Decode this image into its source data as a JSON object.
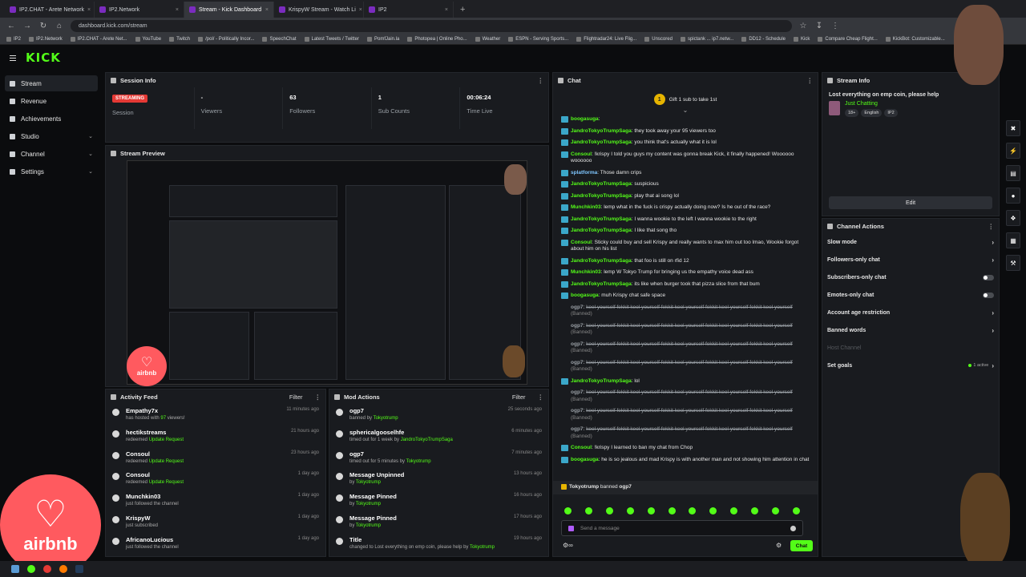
{
  "browser": {
    "tabs": [
      {
        "title": "IP2.CHAT - Arete Network",
        "active": false
      },
      {
        "title": "IP2.Network",
        "active": false
      },
      {
        "title": "Stream - Kick Dashboard",
        "active": true
      },
      {
        "title": "KrispyW Stream - Watch Li",
        "active": false
      },
      {
        "title": "IP2",
        "active": false
      }
    ],
    "new_tab": "+",
    "url": "dashboard.kick.com/stream",
    "bookmarks": [
      "IP2",
      "IP2.Network",
      "IP2.CHAT - Arete Net...",
      "YouTube",
      "Twitch",
      "/pol/ - Politically Incor...",
      "SpeechChat",
      "Latest Tweets / Twitter",
      "PomfJain.la",
      "Photopea | Online Pho...",
      "Weather",
      "ESPN - Serving Sports...",
      "Flightradar24: Live Flig...",
      "Unscored",
      "spictank ... ip7.netw...",
      "DD12 - Schedule",
      "Kick",
      "Compare Cheap Flight...",
      "KickBot: Customizable..."
    ]
  },
  "app": {
    "logo": "KICK"
  },
  "sidebar": {
    "items": [
      {
        "label": "Stream",
        "active": true,
        "chevron": false
      },
      {
        "label": "Revenue",
        "active": false,
        "chevron": false
      },
      {
        "label": "Achievements",
        "active": false,
        "chevron": false
      },
      {
        "label": "Studio",
        "active": false,
        "chevron": true
      },
      {
        "label": "Channel",
        "active": false,
        "chevron": true
      },
      {
        "label": "Settings",
        "active": false,
        "chevron": true
      }
    ]
  },
  "session": {
    "title": "Session Info",
    "status": "STREAMING",
    "status_label": "Session",
    "stats": [
      {
        "value": "-",
        "label": "Viewers"
      },
      {
        "value": "63",
        "label": "Followers"
      },
      {
        "value": "1",
        "label": "Sub Counts"
      },
      {
        "value": "00:06:24",
        "label": "Time Live"
      }
    ]
  },
  "preview": {
    "title": "Stream Preview",
    "overlay_brand": "airbnb"
  },
  "activity": {
    "title": "Activity Feed",
    "filter": "Filter",
    "items": [
      {
        "name": "Empathy7x",
        "pre": "has hosted with ",
        "hl": "97",
        "post": " viewers!",
        "time": "11 minutes ago"
      },
      {
        "name": "hectikstreams",
        "pre": "redeemed ",
        "hl": "Update Request",
        "post": "",
        "time": "21 hours ago"
      },
      {
        "name": "Consoul",
        "pre": "redeemed ",
        "hl": "Update Request",
        "post": "",
        "time": "23 hours ago"
      },
      {
        "name": "Consoul",
        "pre": "redeemed ",
        "hl": "Update Request",
        "post": "",
        "time": "1 day ago"
      },
      {
        "name": "Munchkin03",
        "pre": "just followed the channel",
        "hl": "",
        "post": "",
        "time": "1 day ago"
      },
      {
        "name": "KrispyW",
        "pre": "just subscribed",
        "hl": "",
        "post": "",
        "time": "1 day ago"
      },
      {
        "name": "AfricanoLucious",
        "pre": "just followed the channel",
        "hl": "",
        "post": "",
        "time": "1 day ago"
      }
    ]
  },
  "mod": {
    "title": "Mod Actions",
    "filter": "Filter",
    "items": [
      {
        "name": "ogp7",
        "pre": "banned by ",
        "hl": "Tokyotrump",
        "time": "25 seconds ago"
      },
      {
        "name": "sphericalgooselhfe",
        "pre": "timed out for 1 week by ",
        "hl": "JandroTokyoTrumpSaga",
        "time": "6 minutes ago"
      },
      {
        "name": "ogp7",
        "pre": "timed out for 5 minutes by ",
        "hl": "Tokyotrump",
        "time": "7 minutes ago"
      },
      {
        "name": "Message Unpinned",
        "pre": "by ",
        "hl": "Tokyotrump",
        "time": "13 hours ago"
      },
      {
        "name": "Message Pinned",
        "pre": "by ",
        "hl": "Tokyotrump",
        "time": "16 hours ago"
      },
      {
        "name": "Message Pinned",
        "pre": "by ",
        "hl": "Tokyotrump",
        "time": "17 hours ago"
      },
      {
        "name": "Title",
        "pre": "changed to Lost everything on emp coin, please help by ",
        "hl": "Tokyotrump",
        "time": "19 hours ago"
      }
    ]
  },
  "chat": {
    "title": "Chat",
    "gift_text": "Gift 1 sub to take 1st",
    "gift_coin": "1",
    "messages": [
      {
        "user": "boogasuga",
        "color": "#53fc18",
        "text": "",
        "banned": false
      },
      {
        "user": "JandroTokyoTrumpSaga",
        "color": "#53fc18",
        "text": "they took away your 95 viewers too",
        "banned": false
      },
      {
        "user": "JandroTokyoTrumpSaga",
        "color": "#53fc18",
        "text": "you think that's actually what it is lol",
        "banned": false
      },
      {
        "user": "Consoul",
        "color": "#53fc18",
        "text": "!krispy I told you guys my content was gonna break Kick, it finally happened! Woooooo woooooo",
        "banned": false
      },
      {
        "user": "splatforma",
        "color": "#7fc6ff",
        "text": "Those damn crips",
        "banned": false
      },
      {
        "user": "JandroTokyoTrumpSaga",
        "color": "#53fc18",
        "text": "suspicious",
        "banned": false
      },
      {
        "user": "JandroTokyoTrumpSaga",
        "color": "#53fc18",
        "text": "play that ai song lol",
        "banned": false
      },
      {
        "user": "Munchkin03",
        "color": "#53fc18",
        "text": "lemp what in the fuck is crispy actually doing now? Is he out of the race?",
        "banned": false
      },
      {
        "user": "JandroTokyoTrumpSaga",
        "color": "#53fc18",
        "text": "I wanna wookie to the left I wanna wookie to the right",
        "banned": false
      },
      {
        "user": "JandroTokyoTrumpSaga",
        "color": "#53fc18",
        "text": "I like that song tho",
        "banned": false
      },
      {
        "user": "Consoul",
        "color": "#53fc18",
        "text": "Sticky could buy and sell Krispy and really wants to max him out too lmao, Wookie forgot about him on his list",
        "banned": false
      },
      {
        "user": "JandroTokyoTrumpSaga",
        "color": "#53fc18",
        "text": "that foo is still on rfid 12",
        "banned": false
      },
      {
        "user": "Munchkin03",
        "color": "#53fc18",
        "text": "lemp W Tokyo Trump for bringing us the empathy voice dead ass",
        "banned": false
      },
      {
        "user": "JandroTokyoTrumpSaga",
        "color": "#53fc18",
        "text": "its like when burger took that pizza slice from that bum",
        "banned": false
      },
      {
        "user": "boogasuga",
        "color": "#53fc18",
        "text": "muh Krispy chat safe space",
        "banned": false
      },
      {
        "user": "ogp7",
        "color": "#9aa0a6",
        "text": "keel yourself fekkit keel yourself fekkit keel yourself fekkit keel yourself fekkit keel yourself",
        "banned": true,
        "ban_label": "(Banned)"
      },
      {
        "user": "ogp7",
        "color": "#9aa0a6",
        "text": "keel yourself fekkit keel yourself fekkit keel yourself fekkit keel yourself fekkit keel yourself",
        "banned": true,
        "ban_label": "(Banned)"
      },
      {
        "user": "ogp7",
        "color": "#9aa0a6",
        "text": "keel yourself fekkit keel yourself fekkit keel yourself fekkit keel yourself fekkit keel yourself",
        "banned": true,
        "ban_label": "(Banned)"
      },
      {
        "user": "ogp7",
        "color": "#9aa0a6",
        "text": "keel yourself fekkit keel yourself fekkit keel yourself fekkit keel yourself fekkit keel yourself",
        "banned": true,
        "ban_label": "(Banned)"
      },
      {
        "user": "JandroTokyoTrumpSaga",
        "color": "#53fc18",
        "text": "lol",
        "banned": false
      },
      {
        "user": "ogp7",
        "color": "#9aa0a6",
        "text": "keel yourself fekkit keel yourself fekkit keel yourself fekkit keel yourself fekkit keel yourself",
        "banned": true,
        "ban_label": "(Banned)"
      },
      {
        "user": "ogp7",
        "color": "#9aa0a6",
        "text": "keel yourself fekkit keel yourself fekkit keel yourself fekkit keel yourself fekkit keel yourself",
        "banned": true,
        "ban_label": "(Banned)"
      },
      {
        "user": "ogp7",
        "color": "#9aa0a6",
        "text": "keel yourself fekkit keel yourself fekkit keel yourself fekkit keel yourself fekkit keel yourself",
        "banned": true,
        "ban_label": "(Banned)"
      },
      {
        "user": "Consoul",
        "color": "#53fc18",
        "text": "!krispy I learned to ban my chat from Chop",
        "banned": false
      },
      {
        "user": "boogasuga",
        "color": "#53fc18",
        "text": "he is so jealous and mad Krispy is with another man and not showing him attention in chat",
        "banned": false
      }
    ],
    "system": {
      "actor": "Tokyotrump",
      "action": " banned ",
      "target": "ogp7"
    },
    "input_placeholder": "Send a message",
    "send_label": "Chat"
  },
  "stream_info": {
    "title": "Stream Info",
    "stream_title": "Lost everything on emp coin, please help",
    "category": "Just Chatting",
    "tags": [
      "18+",
      "English",
      "IP2"
    ],
    "edit_label": "Edit"
  },
  "channel_actions": {
    "title": "Channel Actions",
    "items": [
      {
        "label": "Slow mode",
        "control": "chevron",
        "extra": ""
      },
      {
        "label": "Followers-only chat",
        "control": "chevron",
        "extra": ""
      },
      {
        "label": "Subscribers-only chat",
        "control": "toggle",
        "extra": ""
      },
      {
        "label": "Emotes-only chat",
        "control": "toggle",
        "extra": ""
      },
      {
        "label": "Account age restriction",
        "control": "chevron",
        "extra": ""
      },
      {
        "label": "Banned words",
        "control": "chevron",
        "extra": ""
      },
      {
        "label": "Host Channel",
        "control": "none",
        "extra": "",
        "disabled": true
      },
      {
        "label": "Set goals",
        "control": "chevron",
        "extra": "1 active"
      }
    ]
  },
  "colors": {
    "accent": "#53fc18",
    "live": "#e53935",
    "airbnb": "#ff5a5f",
    "panel": "#191b1f",
    "bg": "#0b0c0e"
  },
  "overlay": {
    "brand": "airbnb"
  }
}
